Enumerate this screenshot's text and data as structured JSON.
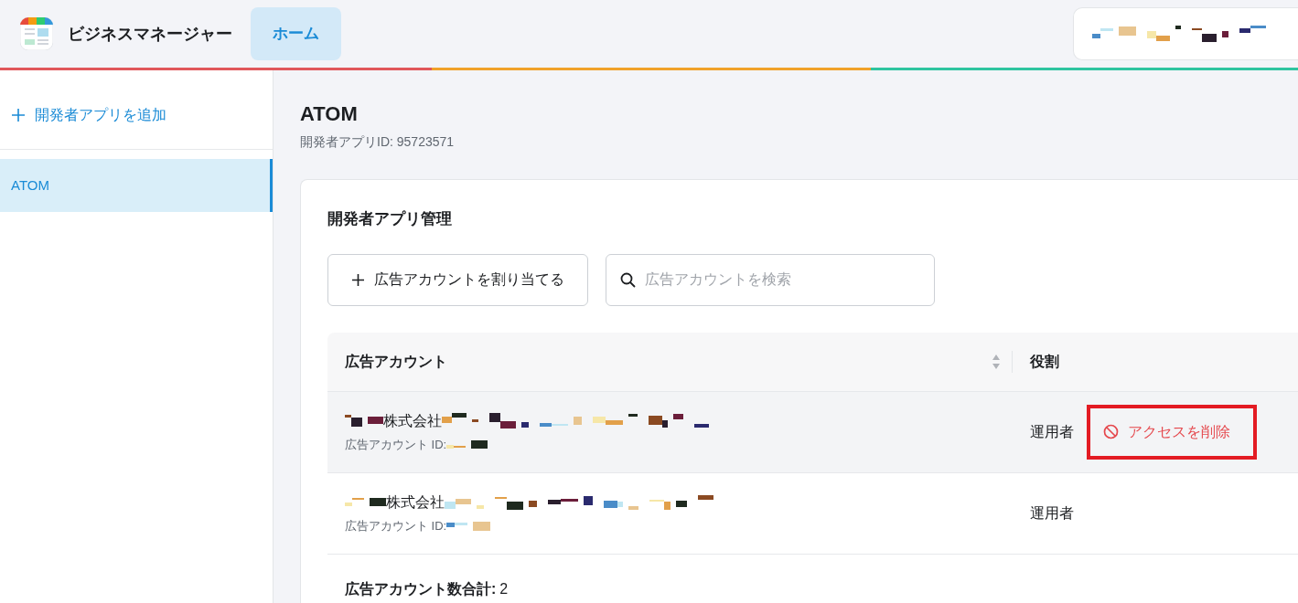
{
  "header": {
    "app_name": "ビジネスマネージャー",
    "tabs": [
      {
        "label": "ホーム",
        "selected": true
      }
    ]
  },
  "sidebar": {
    "add_label": "開発者アプリを追加",
    "items": [
      {
        "label": "ATOM",
        "selected": true
      }
    ]
  },
  "page": {
    "title": "ATOM",
    "subtitle": "開発者アプリID: 95723571"
  },
  "card": {
    "title": "開発者アプリ管理",
    "assign_button": "広告アカウントを割り当てる",
    "search": {
      "placeholder": "広告アカウントを検索"
    },
    "table": {
      "columns": [
        "広告アカウント",
        "役割"
      ],
      "rows": [
        {
          "name": "株式会社",
          "id_label": "広告アカウント ID:",
          "role": "運用者",
          "hovered": true,
          "action": "アクセスを削除",
          "highlighted": true
        },
        {
          "name": "株式会社",
          "id_label": "広告アカウント ID:",
          "role": "運用者",
          "hovered": false
        }
      ]
    },
    "total_label": "広告アカウント数合計:",
    "total_value": "2"
  }
}
